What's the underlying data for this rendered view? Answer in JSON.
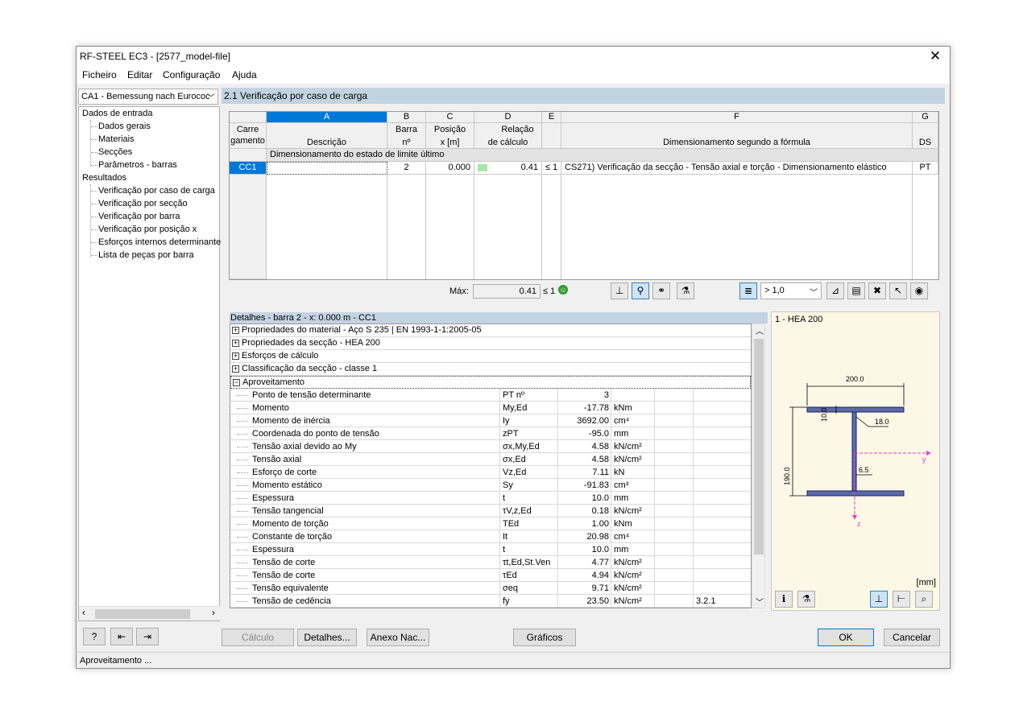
{
  "window": {
    "title": "RF-STEEL EC3 - [2577_model-file]"
  },
  "menu": [
    "Ficheiro",
    "Editar",
    "Configuração",
    "Ajuda"
  ],
  "nav": {
    "combo": "CA1 - Bemessung nach Eurococ",
    "tree": [
      {
        "label": "Dados de entrada",
        "level": 0
      },
      {
        "label": "Dados gerais",
        "level": 1
      },
      {
        "label": "Materiais",
        "level": 1
      },
      {
        "label": "Secções",
        "level": 1
      },
      {
        "label": "Parâmetros - barras",
        "level": 1
      },
      {
        "label": "Resultados",
        "level": 0
      },
      {
        "label": "Verificação por caso de carga",
        "level": 1
      },
      {
        "label": "Verificação por secção",
        "level": 1
      },
      {
        "label": "Verificação por barra",
        "level": 1
      },
      {
        "label": "Verificação por posição x",
        "level": 1
      },
      {
        "label": "Esforços internos determinante",
        "level": 1
      },
      {
        "label": "Lista de peças por barra",
        "level": 1
      }
    ]
  },
  "panel": {
    "title": "2.1 Verificação por caso de carga"
  },
  "grid": {
    "letters": {
      "a": "A",
      "b": "B",
      "c": "C",
      "d": "D",
      "e": "E",
      "f": "F",
      "g": "G"
    },
    "h_carre1": "Carre",
    "h_carre2": "gamento",
    "h_desc": "Descrição",
    "h_barra1": "Barra",
    "h_barra2": "nº",
    "h_pos1": "Posição",
    "h_pos2": "x [m]",
    "h_rel1": "Relação",
    "h_rel2": "de cálculo",
    "h_dim": "Dimensionamento segundo a fórmula",
    "h_ds": "DS",
    "group_label": "Dimensionamento do estado de limite último",
    "row": {
      "lc": "CC1",
      "desc": "",
      "barra": "2",
      "pos": "0.000",
      "ratio": "0.41",
      "le": "≤ 1",
      "formula": "CS271) Verificação da secção - Tensão axial e torção - Dimensionamento elástico",
      "ds": "PT"
    },
    "max_label": "Máx:",
    "max_value": "0.41",
    "max_le": "≤ 1",
    "filter": "> 1,0"
  },
  "details": {
    "title": "Detalhes - barra 2 - x: 0.000 m - CC1",
    "groups": [
      {
        "sign": "+",
        "label": "Propriedades do material - Aço S 235 | EN 1993-1-1:2005-05"
      },
      {
        "sign": "+",
        "label": "Propriedades da secção  -  HEA 200"
      },
      {
        "sign": "+",
        "label": "Esforços de cálculo"
      },
      {
        "sign": "+",
        "label": "Classificação da secção - classe 1"
      },
      {
        "sign": "−",
        "label": "Aproveitamento"
      }
    ],
    "rows": [
      {
        "name": "Ponto de tensão determinante",
        "sym": "PT nº",
        "val": "3",
        "unit": "",
        "ref": ""
      },
      {
        "name": "Momento",
        "sym": "My,Ed",
        "val": "-17.78",
        "unit": "kNm",
        "ref": ""
      },
      {
        "name": "Momento de inércia",
        "sym": "Iy",
        "val": "3692.00",
        "unit": "cm⁴",
        "ref": ""
      },
      {
        "name": "Coordenada do ponto de tensão",
        "sym": "zPT",
        "val": "-95.0",
        "unit": "mm",
        "ref": ""
      },
      {
        "name": "Tensão axial devido ao My",
        "sym": "σx,My,Ed",
        "val": "4.58",
        "unit": "kN/cm²",
        "ref": ""
      },
      {
        "name": "Tensão axial",
        "sym": "σx,Ed",
        "val": "4.58",
        "unit": "kN/cm²",
        "ref": ""
      },
      {
        "name": "Esforço de corte",
        "sym": "Vz,Ed",
        "val": "7.11",
        "unit": "kN",
        "ref": ""
      },
      {
        "name": "Momento estático",
        "sym": "Sy",
        "val": "-91.83",
        "unit": "cm³",
        "ref": ""
      },
      {
        "name": "Espessura",
        "sym": "t",
        "val": "10.0",
        "unit": "mm",
        "ref": ""
      },
      {
        "name": "Tensão tangencial",
        "sym": "τV,z,Ed",
        "val": "0.18",
        "unit": "kN/cm²",
        "ref": ""
      },
      {
        "name": "Momento de torção",
        "sym": "TEd",
        "val": "1.00",
        "unit": "kNm",
        "ref": ""
      },
      {
        "name": "Constante de torção",
        "sym": "It",
        "val": "20.98",
        "unit": "cm⁴",
        "ref": ""
      },
      {
        "name": "Espessura",
        "sym": "t",
        "val": "10.0",
        "unit": "mm",
        "ref": ""
      },
      {
        "name": "Tensão de corte",
        "sym": "τt,Ed,St.Ven",
        "val": "4.77",
        "unit": "kN/cm²",
        "ref": ""
      },
      {
        "name": "Tensão de corte",
        "sym": "τEd",
        "val": "4.94",
        "unit": "kN/cm²",
        "ref": ""
      },
      {
        "name": "Tensão equivalente",
        "sym": "σeq",
        "val": "9.71",
        "unit": "kN/cm²",
        "ref": ""
      },
      {
        "name": "Tensão de cedência",
        "sym": "fy",
        "val": "23.50",
        "unit": "kN/cm²",
        "ref": "3.2.1"
      }
    ]
  },
  "section": {
    "title": "1 - HEA 200",
    "dim_b": "200.0",
    "dim_h": "190.0",
    "dim_tf": "10.0",
    "dim_r": "18.0",
    "dim_tw": "6.5",
    "axis_y": "y",
    "axis_z": "z",
    "unit": "[mm]"
  },
  "buttons": {
    "calc": "Cálculo",
    "details": "Detalhes...",
    "annex": "Anexo Nac...",
    "graphics": "Gráficos",
    "ok": "OK",
    "cancel": "Cancelar"
  },
  "status": "Aproveitamento ..."
}
